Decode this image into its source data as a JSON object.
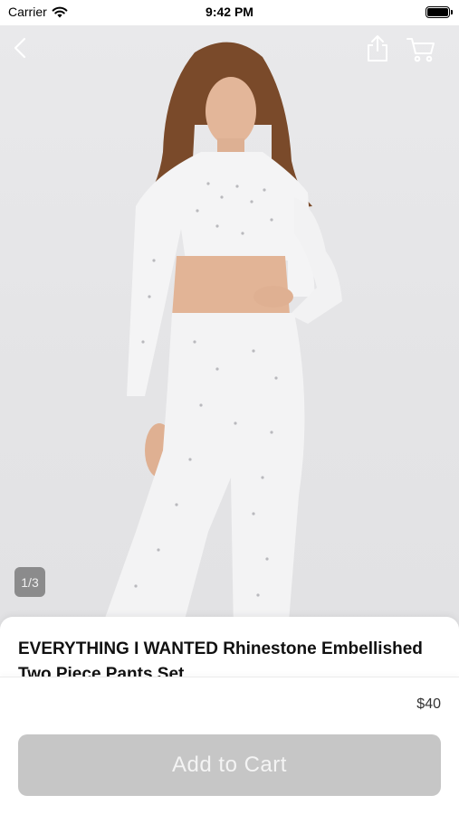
{
  "status_bar": {
    "carrier": "Carrier",
    "time": "9:42 PM"
  },
  "nav": {
    "back_icon": "chevron-left-icon",
    "share_icon": "share-icon",
    "cart_icon": "cart-icon"
  },
  "gallery": {
    "counter": "1/3",
    "colors": {
      "background": "#e5e5e7"
    }
  },
  "product": {
    "title": "EVERYTHING I WANTED Rhinestone Embellished Two Piece Pants Set",
    "price": "$40"
  },
  "actions": {
    "add_to_cart_label": "Add to Cart",
    "button_color": "#c6c6c6"
  }
}
